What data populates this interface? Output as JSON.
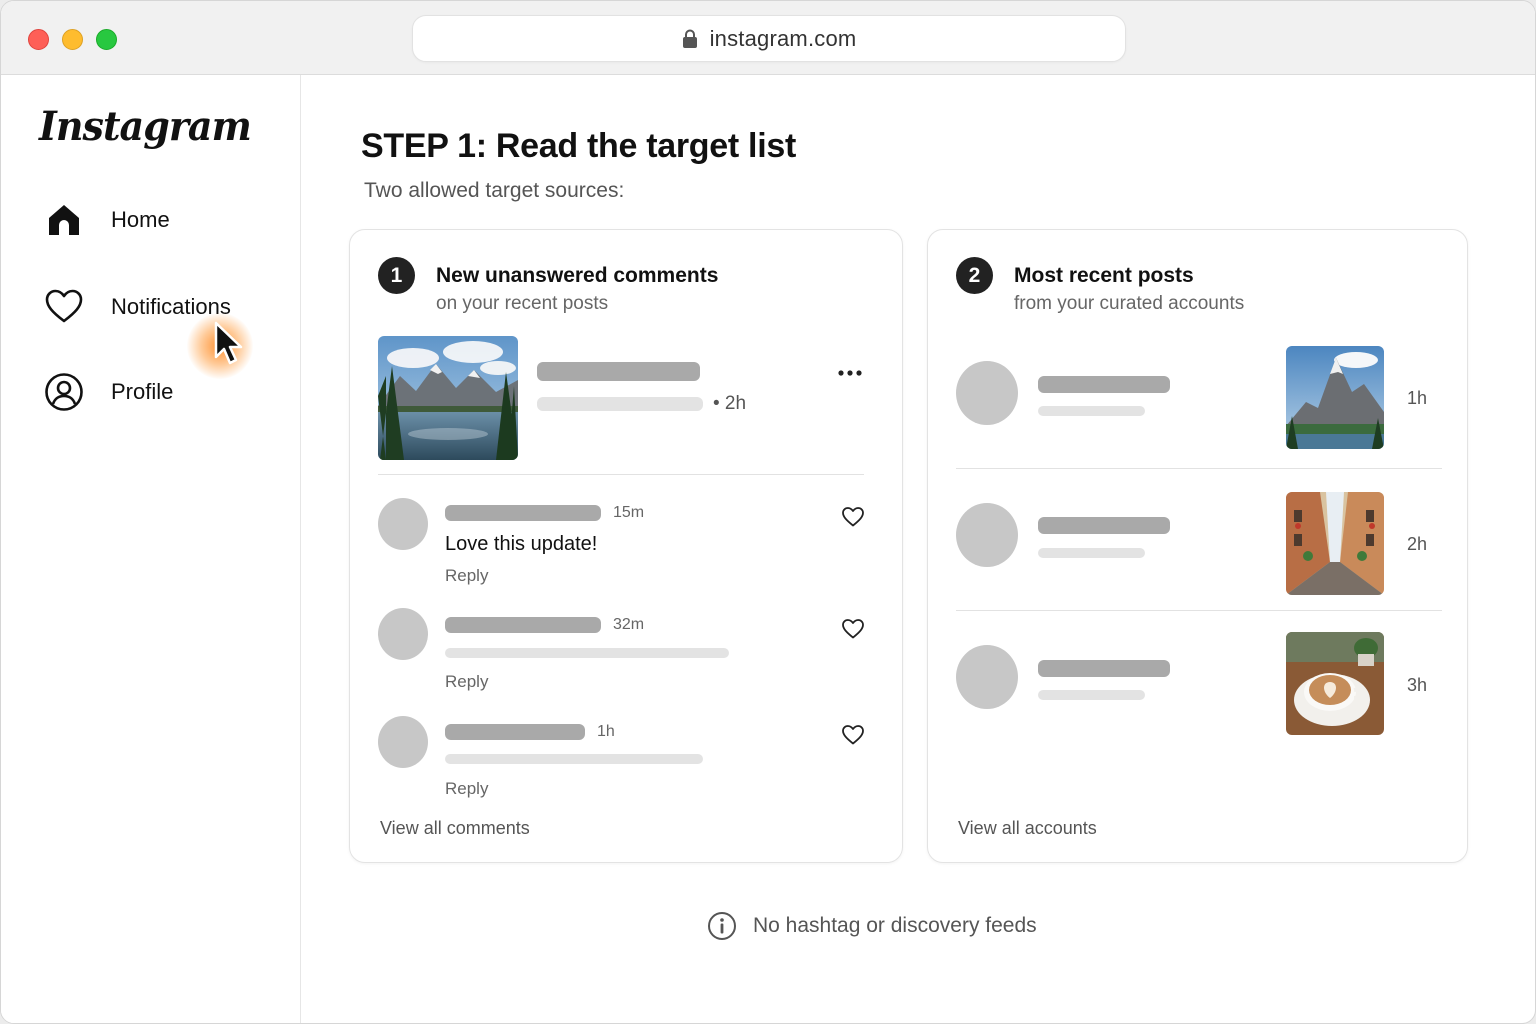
{
  "browser": {
    "url": "instagram.com",
    "icons": {
      "lock": "lock-icon"
    }
  },
  "sidebar": {
    "logo": "Instagram",
    "items": [
      {
        "label": "Home",
        "icon": "home-icon"
      },
      {
        "label": "Notifications",
        "icon": "heart-outline-icon"
      },
      {
        "label": "Profile",
        "icon": "user-circle-icon"
      }
    ]
  },
  "main": {
    "title": "STEP 1: Read the target list",
    "subtitle": "Two allowed target sources:",
    "card1": {
      "number": "1",
      "title": "New unanswered comments",
      "subtitle": "on your recent posts",
      "post_time": "• 2h",
      "comments": [
        {
          "time": "15m",
          "text": "Love this update!",
          "reply": "Reply"
        },
        {
          "time": "32m",
          "text": "",
          "reply": "Reply"
        },
        {
          "time": "1h",
          "text": "",
          "reply": "Reply"
        }
      ],
      "view_all": "View all comments"
    },
    "card2": {
      "number": "2",
      "title": "Most recent posts",
      "subtitle": "from your curated accounts",
      "rows": [
        {
          "time": "1h",
          "thumb": "mountain-photo"
        },
        {
          "time": "2h",
          "thumb": "street-photo"
        },
        {
          "time": "3h",
          "thumb": "coffee-photo"
        }
      ],
      "view_all": "View all accounts"
    },
    "footer_note": "No hashtag or discovery feeds"
  },
  "colors": {
    "accent_cursor_glow": "#ff8c28",
    "badge": "#222222",
    "skeleton_dark": "#a9a9a9",
    "skeleton_light": "#e3e3e3",
    "avatar": "#c7c7c7"
  }
}
